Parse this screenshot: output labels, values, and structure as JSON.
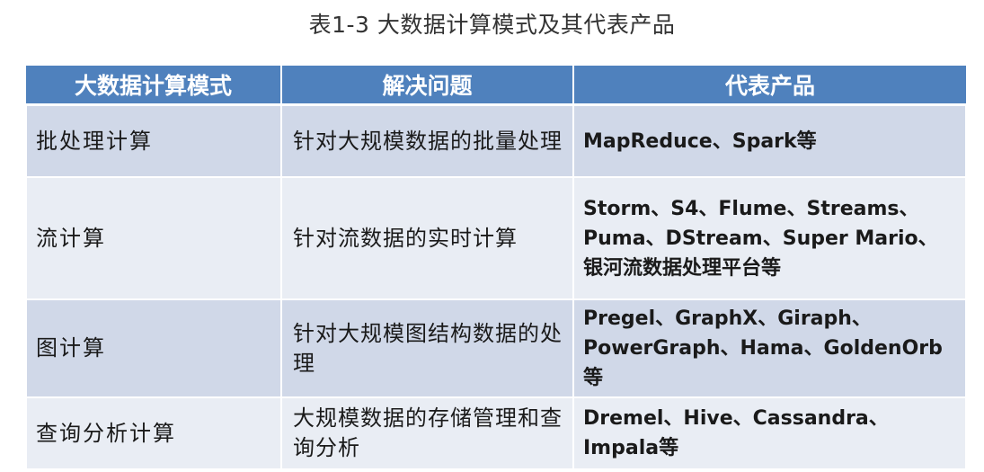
{
  "caption": "表1-3 大数据计算模式及其代表产品",
  "table": {
    "headers": [
      "大数据计算模式",
      "解决问题",
      "代表产品"
    ],
    "rows": [
      {
        "mode": "批处理计算",
        "problem": "针对大规模数据的批量处理",
        "products": "MapReduce、Spark等"
      },
      {
        "mode": "流计算",
        "problem": "针对流数据的实时计算",
        "products": "Storm、S4、Flume、Streams、Puma、DStream、Super Mario、银河流数据处理平台等"
      },
      {
        "mode": "图计算",
        "problem": "针对大规模图结构数据的处理",
        "products": "Pregel、GraphX、Giraph、PowerGraph、Hama、GoldenOrb等"
      },
      {
        "mode": "查询分析计算",
        "problem": "大规模数据的存储管理和查询分析",
        "products": "Dremel、Hive、Cassandra、Impala等"
      }
    ]
  },
  "colors": {
    "header_bg": "#4f81bd",
    "row_odd_bg": "#d0d8e8",
    "row_even_bg": "#e9edf4"
  }
}
